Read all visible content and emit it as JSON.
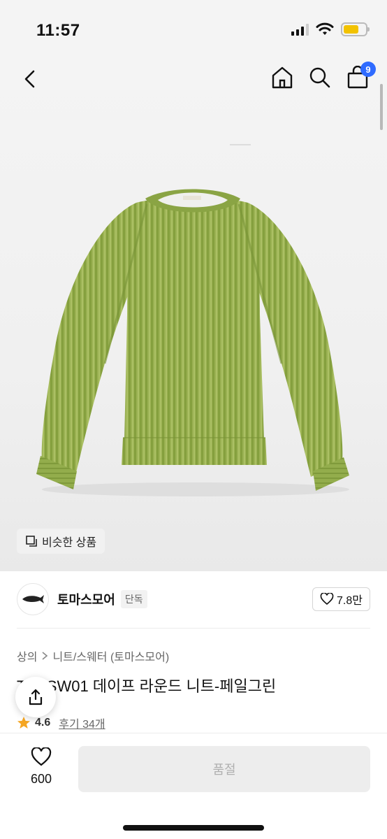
{
  "status_bar": {
    "time": "11:57",
    "battery_color": "#f2c200"
  },
  "header": {
    "back_icon": "chevron-left-icon",
    "home_icon": "home-icon",
    "search_icon": "search-icon",
    "cart_icon": "shopping-bag-icon",
    "cart_count": "9",
    "badge_color": "#2f6bff"
  },
  "image": {
    "description_icon": "sweater-photo",
    "similar_label": "비슷한 상품"
  },
  "brand": {
    "name": "토마스모어",
    "tag": "단독",
    "likes": "7.8만"
  },
  "breadcrumb": {
    "root": "상의",
    "category": "니트/스웨터 (토마스모어)"
  },
  "product": {
    "title": "T…-SW01 데이프 라운드 니트-페일그린",
    "rating": "4.6",
    "reviews": "후기 34개"
  },
  "bottom": {
    "wish_count": "600",
    "buy_label": "품절"
  }
}
